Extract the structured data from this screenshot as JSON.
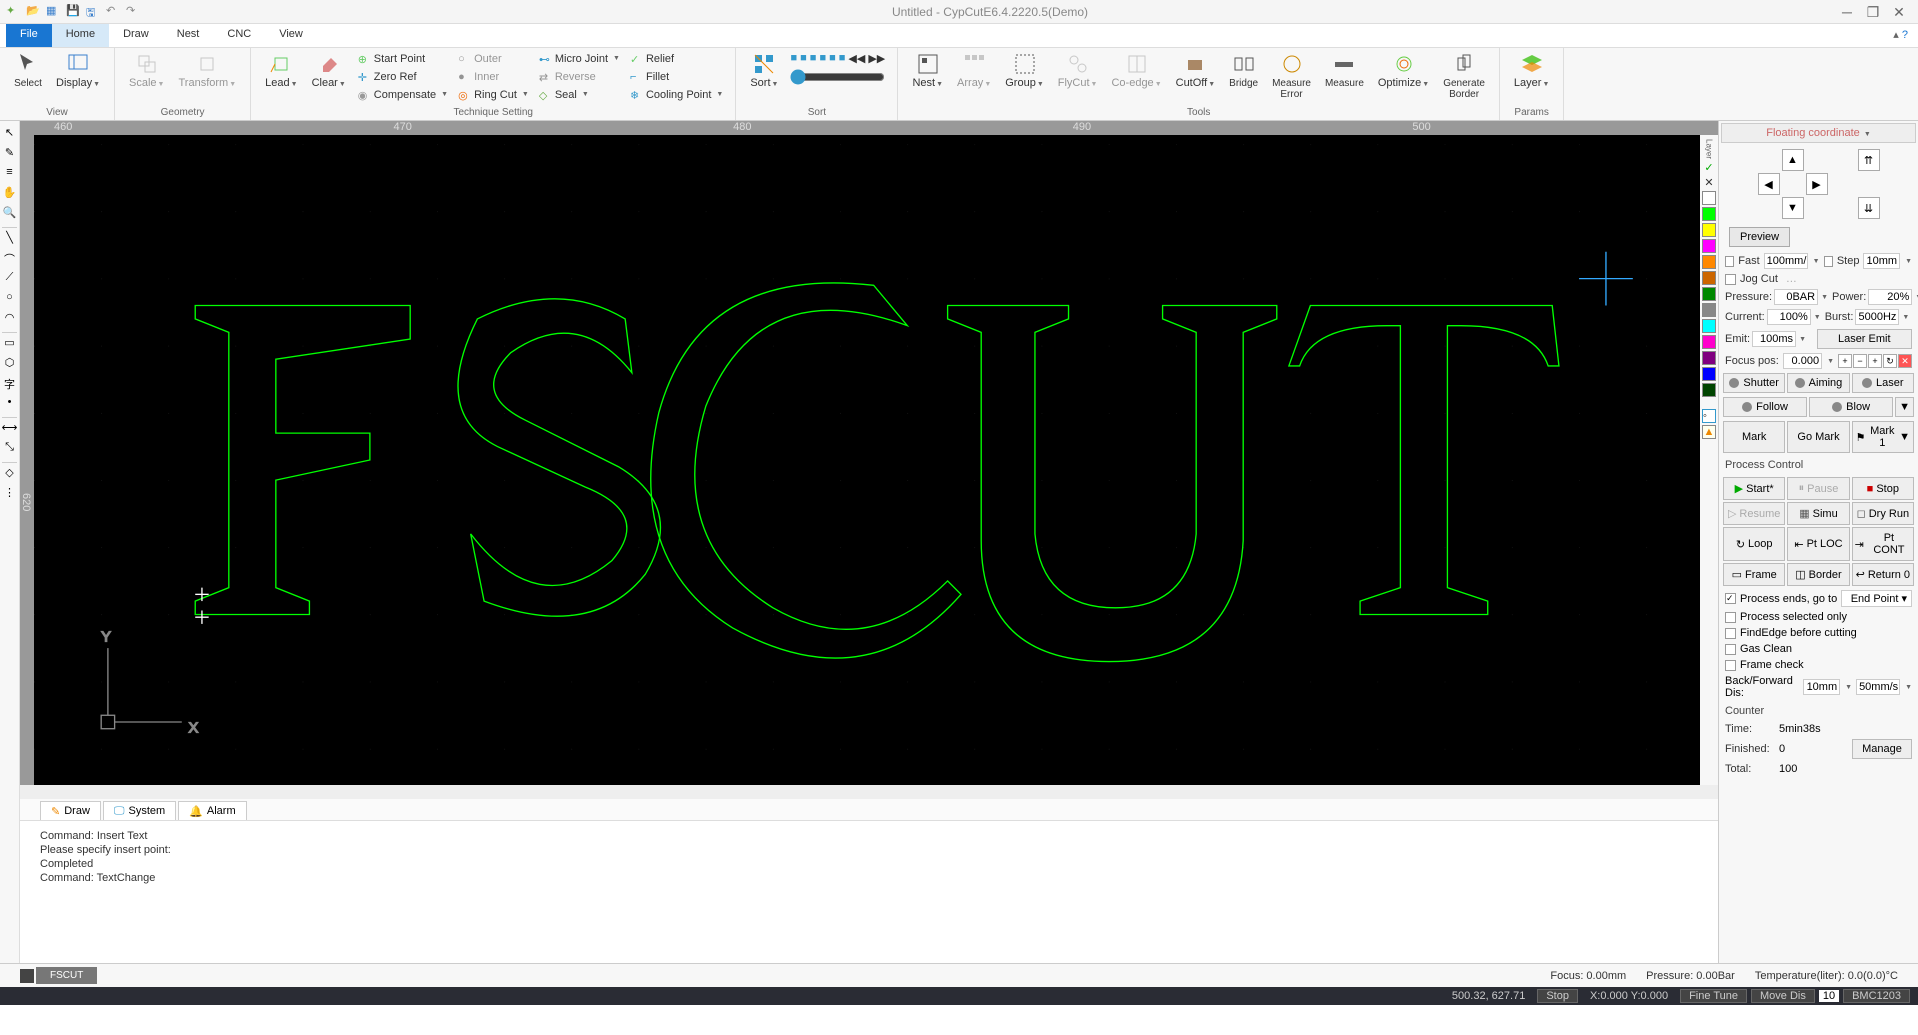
{
  "title": "Untitled - CypCutE6.4.2220.5(Demo)",
  "menus": {
    "file": "File",
    "home": "Home",
    "draw": "Draw",
    "nest": "Nest",
    "cnc": "CNC",
    "view": "View"
  },
  "ribbon": {
    "view": {
      "label": "View",
      "select": "Select",
      "display": "Display"
    },
    "geometry": {
      "label": "Geometry",
      "scale": "Scale",
      "transform": "Transform"
    },
    "technique": {
      "label": "Technique Setting",
      "lead": "Lead",
      "clear": "Clear",
      "start_point": "Start Point",
      "zero_ref": "Zero Ref",
      "compensate": "Compensate",
      "outer": "Outer",
      "inner": "Inner",
      "ring_cut": "Ring Cut",
      "micro_joint": "Micro Joint",
      "reverse": "Reverse",
      "seal": "Seal",
      "relief": "Relief",
      "fillet": "Fillet",
      "cooling_point": "Cooling Point"
    },
    "sort": {
      "label": "Sort",
      "sort": "Sort"
    },
    "tools": {
      "label": "Tools",
      "nest": "Nest",
      "array": "Array",
      "group": "Group",
      "flycut": "FlyCut",
      "coedge": "Co-edge",
      "cutoff": "CutOff",
      "bridge": "Bridge",
      "measure_error": "Measure\nError",
      "measure": "Measure",
      "optimize": "Optimize",
      "generate_border": "Generate\nBorder"
    },
    "params": {
      "label": "Params",
      "layer": "Layer"
    }
  },
  "right": {
    "coord_mode": "Floating coordinate",
    "preview": "Preview",
    "fast": "Fast",
    "fast_val": "100mm/",
    "step": "Step",
    "step_val": "10mm",
    "jog_cut": "Jog Cut",
    "pressure": "Pressure:",
    "pressure_val": "0BAR",
    "power": "Power:",
    "power_val": "20%",
    "current": "Current:",
    "current_val": "100%",
    "burst": "Burst:",
    "burst_val": "5000Hz",
    "emit": "Emit:",
    "emit_val": "100ms",
    "laser_emit": "Laser Emit",
    "focus_pos": "Focus pos:",
    "focus_val": "0.000",
    "shutter": "Shutter",
    "aiming": "Aiming",
    "laser": "Laser",
    "follow": "Follow",
    "blow": "Blow",
    "mark": "Mark",
    "go_mark": "Go Mark",
    "mark1": "Mark 1",
    "process_control": "Process Control",
    "start": "Start*",
    "pause": "Pause",
    "stop": "Stop",
    "resume": "Resume",
    "simu": "Simu",
    "dry_run": "Dry Run",
    "loop": "Loop",
    "pt_loc": "Pt LOC",
    "pt_cont": "Pt CONT",
    "frame": "Frame",
    "border": "Border",
    "return0": "Return 0",
    "process_ends": "Process ends, go to",
    "end_point": "End Point",
    "process_selected": "Process selected only",
    "findedge": "FindEdge before cutting",
    "gas_clean": "Gas Clean",
    "frame_check": "Frame check",
    "back_forward": "Back/Forward Dis:",
    "bf_dis": "10mm",
    "bf_speed": "50mm/s",
    "counter": "Counter",
    "time": "Time:",
    "time_val": "5min38s",
    "finished": "Finished:",
    "finished_val": "0",
    "total": "Total:",
    "total_val": "100",
    "manage": "Manage"
  },
  "log": {
    "tabs": {
      "draw": "Draw",
      "system": "System",
      "alarm": "Alarm"
    },
    "lines": [
      "Command: Insert Text",
      "Please specify insert point:",
      "Completed",
      "Command: TextChange"
    ]
  },
  "doc_tab": "FSCUT",
  "doc_status": {
    "focus": "Focus:   0.00mm",
    "pressure": "Pressure:  0.00Bar",
    "temperature": "Temperature(liter):  0.0(0.0)°C"
  },
  "statusbar": {
    "coords": "500.32, 627.71",
    "stop": "Stop",
    "xy": "X:0.000 Y:0.000",
    "fine": "Fine Tune",
    "move": "Move Dis",
    "move_val": "10",
    "bmc": "BMC1203"
  },
  "ruler_h": [
    "460",
    "470",
    "480",
    "490",
    "500"
  ],
  "ruler_v": [
    "620"
  ],
  "layer_colors": [
    "#00ff00",
    "#ffff00",
    "#ff00ff",
    "#cccccc",
    "#0000ff",
    "#ff8800",
    "#cc0000",
    "#008800",
    "#800080",
    "#00ffff",
    "#0088ff",
    "#004400"
  ]
}
